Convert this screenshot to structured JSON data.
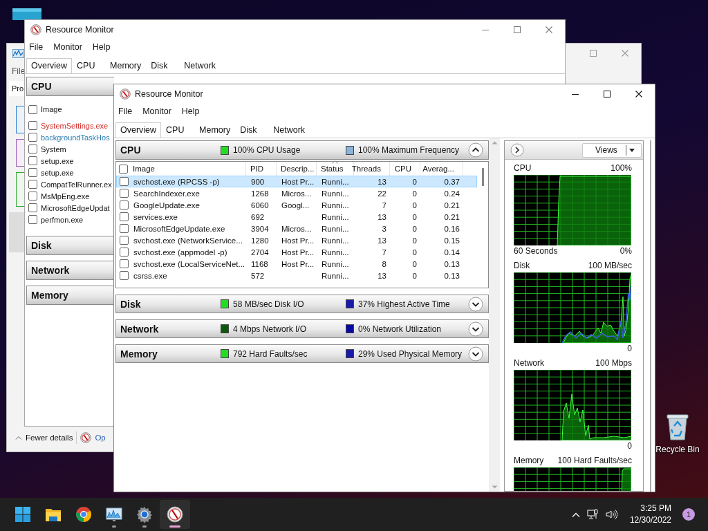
{
  "desktop": {
    "recycle_bin": {
      "label": "Recycle Bin"
    }
  },
  "task_manager": {
    "menu": [
      {
        "label": "File"
      }
    ],
    "tabs": [
      {
        "label": "Pro",
        "selected": true
      }
    ],
    "footer": {
      "toggle": "Fewer details",
      "link": "Op"
    }
  },
  "resource_monitor_back": {
    "title": "Resource Monitor",
    "menu": [
      {
        "label": "File"
      },
      {
        "label": "Monitor"
      },
      {
        "label": "Help"
      }
    ],
    "tabs": [
      {
        "label": "Overview",
        "selected": true
      },
      {
        "label": "CPU",
        "selected": false
      },
      {
        "label": "Memory",
        "selected": false
      },
      {
        "label": "Disk",
        "selected": false
      },
      {
        "label": "Network",
        "selected": false
      }
    ],
    "sections": [
      {
        "title": "CPU",
        "list_header": {
          "label": "Image",
          "checked": false
        },
        "processes": [
          {
            "name": "SystemSettings.exe",
            "kind": "not_responding",
            "checked": false
          },
          {
            "name": "backgroundTaskHos",
            "kind": "suspended",
            "checked": false
          },
          {
            "name": "System",
            "kind": "normal",
            "checked": false
          },
          {
            "name": "setup.exe",
            "kind": "normal",
            "checked": false
          },
          {
            "name": "setup.exe",
            "kind": "normal",
            "checked": false
          },
          {
            "name": "CompatTelRunner.ex",
            "kind": "normal",
            "checked": false
          },
          {
            "name": "MsMpEng.exe",
            "kind": "normal",
            "checked": false
          },
          {
            "name": "MicrosoftEdgeUpdat",
            "kind": "normal",
            "checked": false
          },
          {
            "name": "perfmon.exe",
            "kind": "normal",
            "checked": false
          }
        ]
      },
      {
        "title": "Disk"
      },
      {
        "title": "Network"
      },
      {
        "title": "Memory"
      }
    ]
  },
  "resource_monitor": {
    "title": "Resource Monitor",
    "menu": [
      {
        "label": "File"
      },
      {
        "label": "Monitor"
      },
      {
        "label": "Help"
      }
    ],
    "tabs": [
      {
        "label": "Overview",
        "selected": true
      },
      {
        "label": "CPU",
        "selected": false
      },
      {
        "label": "Memory",
        "selected": false
      },
      {
        "label": "Disk",
        "selected": false
      },
      {
        "label": "Network",
        "selected": false
      }
    ],
    "sections": [
      {
        "title": "CPU",
        "expanded": true,
        "metrics": [
          {
            "text": "100% CPU Usage",
            "color": "#22dd22"
          },
          {
            "text": "100% Maximum Frequency",
            "color": "#8ab4d8"
          }
        ],
        "table": {
          "select_all_checked": false,
          "columns": [
            {
              "label": "Image",
              "sorted": false
            },
            {
              "label": "PID",
              "sorted": false
            },
            {
              "label": "Descrip...",
              "sorted": false
            },
            {
              "label": "Status",
              "sorted": true
            },
            {
              "label": "Threads",
              "sorted": false
            },
            {
              "label": "CPU",
              "sorted": false
            },
            {
              "label": "Averag...",
              "sorted": false
            }
          ],
          "rows": [
            {
              "selected": true,
              "checked": false,
              "image": "svchost.exe (RPCSS -p)",
              "pid": "900",
              "description": "Host Pr...",
              "status": "Runni...",
              "threads": "13",
              "cpu": "0",
              "average": "0.37"
            },
            {
              "selected": false,
              "checked": false,
              "image": "SearchIndexer.exe",
              "pid": "1268",
              "description": "Micros...",
              "status": "Runni...",
              "threads": "22",
              "cpu": "0",
              "average": "0.24"
            },
            {
              "selected": false,
              "checked": false,
              "image": "GoogleUpdate.exe",
              "pid": "6060",
              "description": "Googl...",
              "status": "Runni...",
              "threads": "7",
              "cpu": "0",
              "average": "0.21"
            },
            {
              "selected": false,
              "checked": false,
              "image": "services.exe",
              "pid": "692",
              "status": "Runni...",
              "threads": "13",
              "cpu": "0",
              "average": "0.21"
            },
            {
              "selected": false,
              "checked": false,
              "image": "MicrosoftEdgeUpdate.exe",
              "pid": "3904",
              "description": "Micros...",
              "status": "Runni...",
              "threads": "3",
              "cpu": "0",
              "average": "0.16"
            },
            {
              "selected": false,
              "checked": false,
              "image": "svchost.exe (NetworkService...",
              "pid": "1280",
              "description": "Host Pr...",
              "status": "Runni...",
              "threads": "13",
              "cpu": "0",
              "average": "0.15"
            },
            {
              "selected": false,
              "checked": false,
              "image": "svchost.exe (appmodel -p)",
              "pid": "2704",
              "description": "Host Pr...",
              "status": "Runni...",
              "threads": "7",
              "cpu": "0",
              "average": "0.14"
            },
            {
              "selected": false,
              "checked": false,
              "image": "svchost.exe (LocalServiceNet...",
              "pid": "1168",
              "description": "Host Pr...",
              "status": "Runni...",
              "threads": "8",
              "cpu": "0",
              "average": "0.13"
            },
            {
              "selected": false,
              "checked": false,
              "image": "csrss.exe",
              "pid": "572",
              "status": "Runni...",
              "threads": "13",
              "cpu": "0",
              "average": "0.13"
            }
          ]
        }
      },
      {
        "title": "Disk",
        "expanded": false,
        "metrics": [
          {
            "text": "58 MB/sec Disk I/O",
            "color": "#22dd22"
          },
          {
            "text": "37% Highest Active Time",
            "color": "#1a1aa8"
          }
        ]
      },
      {
        "title": "Network",
        "expanded": false,
        "metrics": [
          {
            "text": "4 Mbps Network I/O",
            "color": "#0a5a0a"
          },
          {
            "text": "0% Network Utilization",
            "color": "#0a0aa0"
          }
        ]
      },
      {
        "title": "Memory",
        "expanded": false,
        "metrics": [
          {
            "text": "792 Hard Faults/sec",
            "color": "#22dd22"
          },
          {
            "text": "29% Used Physical Memory",
            "color": "#1a1aa8"
          }
        ]
      }
    ],
    "side_panel": {
      "views_button": "Views",
      "graphs": [
        {
          "kind": "cpu",
          "label": "CPU",
          "scale": "100%",
          "time_span": "60 Seconds",
          "floor": "0%"
        },
        {
          "kind": "disk",
          "label": "Disk",
          "scale": "100 MB/sec",
          "floor": "0"
        },
        {
          "kind": "network",
          "label": "Network",
          "scale": "100 Mbps",
          "floor": "0"
        },
        {
          "kind": "memory",
          "label": "Memory",
          "scale": "100 Hard Faults/sec"
        }
      ]
    }
  },
  "taskbar": {
    "apps": [
      {
        "kind": "start",
        "running": false,
        "active": false
      },
      {
        "kind": "explorer",
        "running": false,
        "active": false
      },
      {
        "kind": "browser",
        "running": false,
        "active": false
      },
      {
        "kind": "perfmon",
        "running": true,
        "active": false
      },
      {
        "kind": "settings",
        "running": true,
        "active": false
      },
      {
        "kind": "resmon",
        "running": true,
        "active": true
      }
    ],
    "clock": {
      "time": "3:25 PM",
      "date": "12/30/2022"
    },
    "notifications": "1"
  }
}
